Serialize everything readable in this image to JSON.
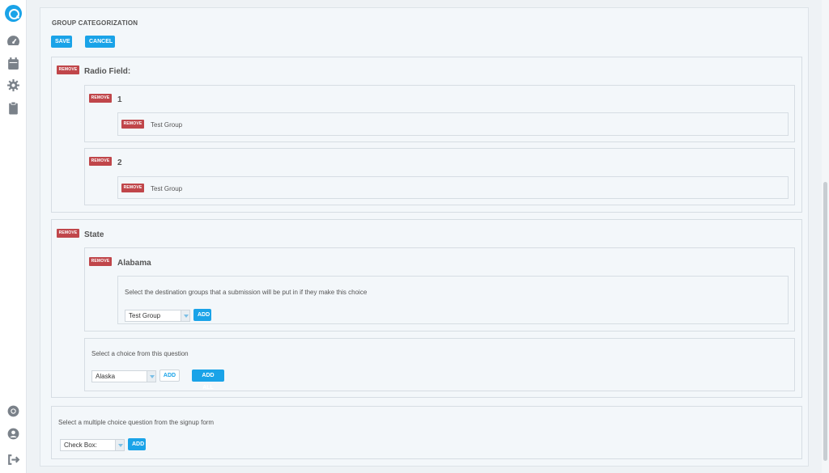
{
  "sidebar": {
    "logo_icon": "search-logo-icon",
    "items": [
      {
        "icon": "dashboard-icon"
      },
      {
        "icon": "calendar-icon"
      },
      {
        "icon": "gear-icon"
      },
      {
        "icon": "clipboard-icon"
      }
    ],
    "bottom_items": [
      {
        "icon": "help-icon"
      },
      {
        "icon": "user-icon"
      },
      {
        "icon": "logout-icon"
      }
    ]
  },
  "page": {
    "title": "GROUP CATEGORIZATION",
    "save_label": "SAVE",
    "cancel_label": "CANCEL"
  },
  "remove_label": "REMOVE",
  "radio_field": {
    "title": "Radio Field:",
    "choices": [
      {
        "label": "1",
        "group": "Test Group"
      },
      {
        "label": "2",
        "group": "Test Group"
      }
    ]
  },
  "state": {
    "title": "State",
    "choice": {
      "label": "Alabama",
      "instruction": "Select the destination groups that a submission will be put in if they make this choice",
      "selected_group": "Test Group",
      "add_label": "ADD"
    },
    "choice_picker": {
      "label": "Select a choice from this question",
      "selected": "Alaska",
      "add_label": "ADD",
      "add_all_label": "ADD ALL"
    }
  },
  "question_picker": {
    "label": "Select a multiple choice question from the signup form",
    "selected": "Check Box:",
    "add_label": "ADD"
  },
  "colors": {
    "accent": "#1aa3e8",
    "remove": "#c0464a"
  }
}
